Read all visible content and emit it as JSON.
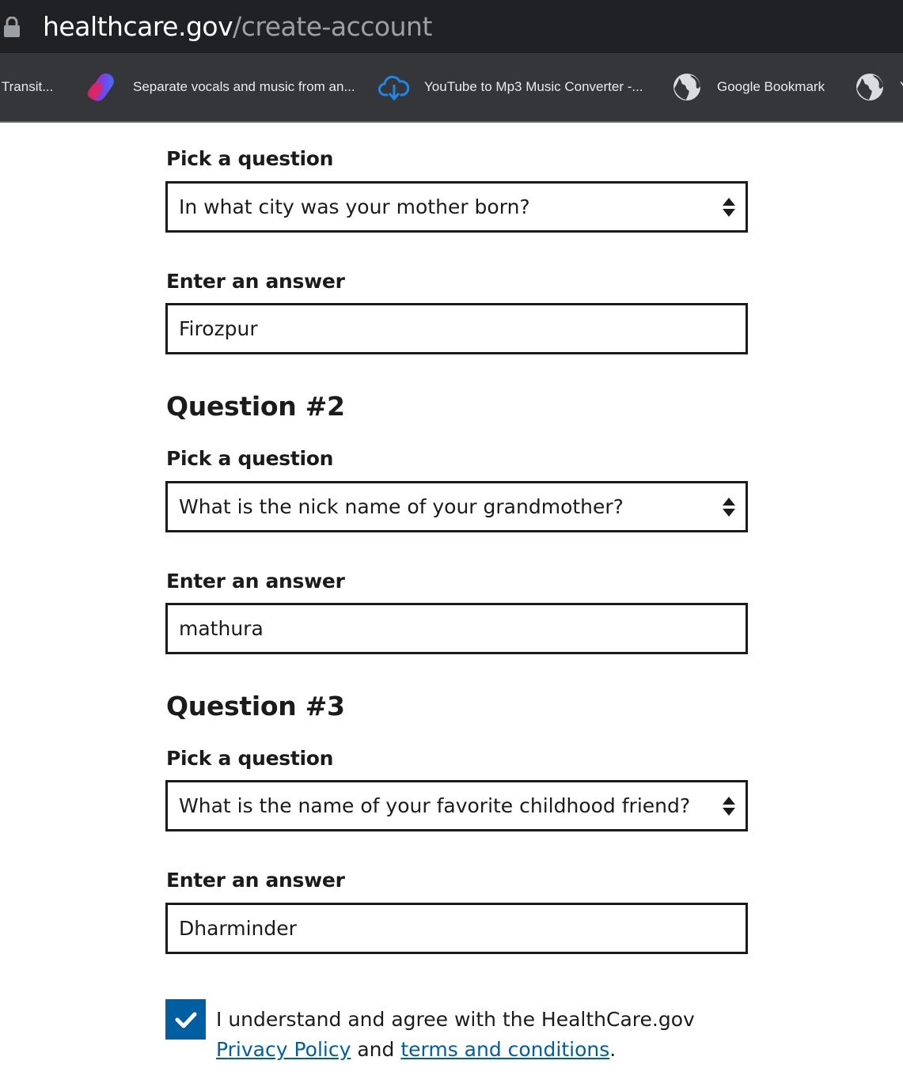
{
  "browser": {
    "url_host": "healthcare.gov",
    "url_path": "/create-account",
    "bookmarks": [
      {
        "label": "o Transit...",
        "icon": "none"
      },
      {
        "label": "Separate vocals and music from an...",
        "icon": "app-logo-icon"
      },
      {
        "label": "YouTube to Mp3 Music Converter -...",
        "icon": "cloud-download-icon"
      },
      {
        "label": "Google Bookmark",
        "icon": "globe-icon"
      },
      {
        "label": "Y",
        "icon": "globe-icon"
      }
    ]
  },
  "form": {
    "question1": {
      "pick_label": "Pick a question",
      "selected_question": "In what city was your mother born?",
      "answer_label": "Enter an answer",
      "answer_value": "Firozpur"
    },
    "question2": {
      "heading": "Question #2",
      "pick_label": "Pick a question",
      "selected_question": "What is the nick name of your grandmother?",
      "answer_label": "Enter an answer",
      "answer_value": "mathura"
    },
    "question3": {
      "heading": "Question #3",
      "pick_label": "Pick a question",
      "selected_question": "What is the name of your favorite childhood friend?",
      "answer_label": "Enter an answer",
      "answer_value": "Dharminder"
    },
    "consent": {
      "checked": true,
      "text_before": "I understand and agree with the HealthCare.gov ",
      "privacy_link": "Privacy Policy",
      "text_middle": " and ",
      "terms_link": "terms and conditions",
      "text_after": "."
    }
  },
  "colors": {
    "chrome_dark": "#202124",
    "bookmarks_bar": "#35363a",
    "accent_blue": "#005ea2",
    "text": "#1b1b1b"
  }
}
